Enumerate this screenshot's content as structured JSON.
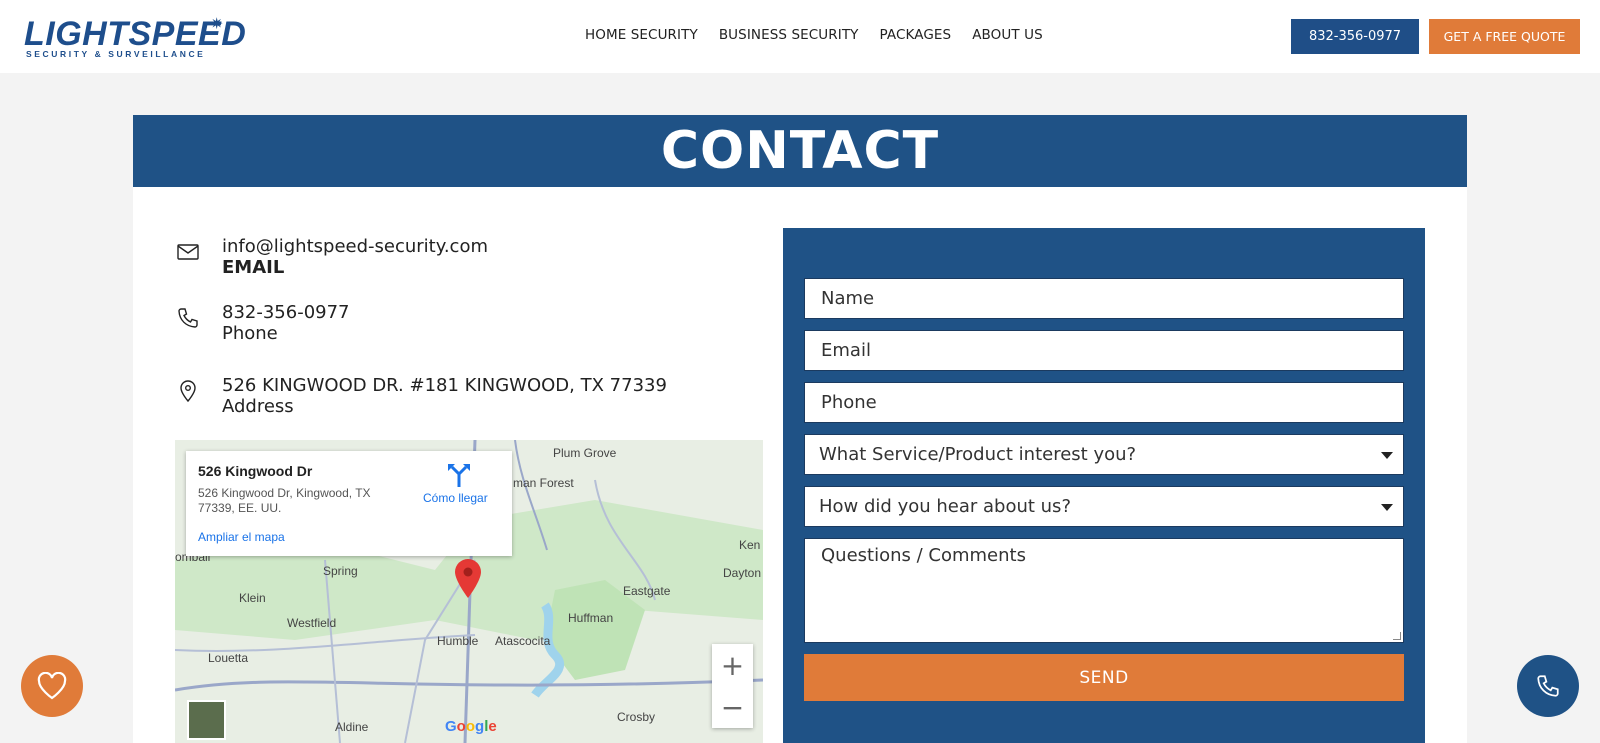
{
  "header": {
    "logo_text": "LIGHTSPEED",
    "logo_tagline": "SECURITY & SURVEILLANCE",
    "nav": [
      "HOME SECURITY",
      "BUSINESS SECURITY",
      "PACKAGES",
      "ABOUT US"
    ],
    "phone_button": "832-356-0977",
    "quote_button": "GET A FREE QUOTE"
  },
  "page": {
    "title": "CONTACT"
  },
  "contact": {
    "email": {
      "value": "info@lightspeed-security.com",
      "label": "EMAIL",
      "icon": "envelope-icon"
    },
    "phone": {
      "value": "832-356-0977",
      "label": "Phone",
      "icon": "phone-icon"
    },
    "address": {
      "value": "526 KINGWOOD DR. #181 KINGWOOD, TX 77339",
      "label": "Address",
      "icon": "map-pin-icon"
    }
  },
  "map": {
    "place_name": "526 Kingwood Dr",
    "place_address": "526 Kingwood Dr, Kingwood, TX 77339, EE. UU.",
    "directions_label": "Cómo llegar",
    "enlarge_label": "Ampliar el mapa",
    "labels": [
      "Plum Grove",
      "man Forest",
      "Spring",
      "Klein",
      "Westfield",
      "Eastgate",
      "Huffman",
      "Dayton",
      "Humble",
      "Atascocita",
      "Louetta",
      "Aldine",
      "Crosby",
      "Ken",
      "ombail"
    ],
    "zoom_in": "+",
    "zoom_out": "−",
    "brand": "Google"
  },
  "form": {
    "name_placeholder": "Name",
    "email_placeholder": "Email",
    "phone_placeholder": "Phone",
    "service_select": "What Service/Product interest you?",
    "source_select": "How did you hear about us?",
    "comments_placeholder": "Questions / Comments",
    "submit": "SEND"
  },
  "colors": {
    "brand_blue": "#1f5286",
    "accent_orange": "#e07b39"
  },
  "floating": {
    "left_icon": "heart-icon",
    "right_icon": "phone-icon"
  }
}
